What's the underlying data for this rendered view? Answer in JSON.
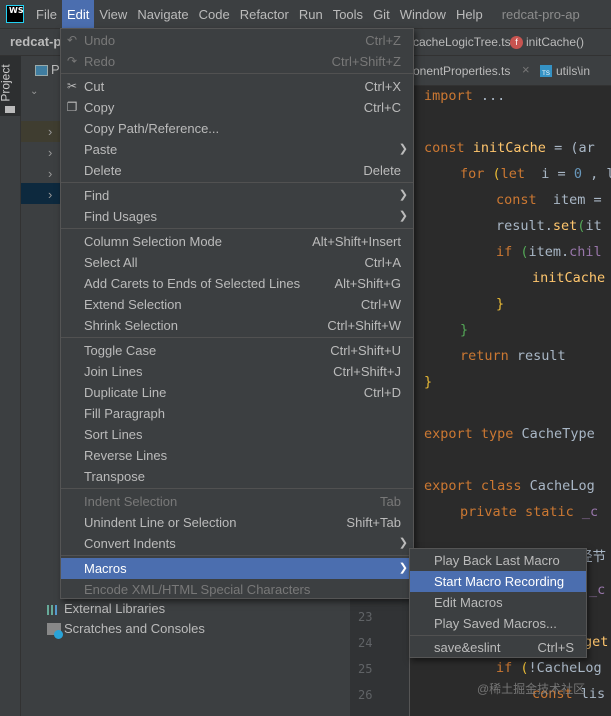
{
  "menubar": {
    "logo": "WS",
    "items": [
      "File",
      "Edit",
      "View",
      "Navigate",
      "Code",
      "Refactor",
      "Run",
      "Tools",
      "Git",
      "Window",
      "Help"
    ],
    "active": "Edit",
    "project_title": "redcat-pro-ap"
  },
  "navbar": {
    "project": "redcat-p",
    "file": "cacheLogicTree.ts",
    "function": "initCache()"
  },
  "tabs": [
    {
      "label": "onentProperties.ts"
    },
    {
      "label": "utils\\in"
    }
  ],
  "tool_window": {
    "label": "Project"
  },
  "project_panel": {
    "header": "P",
    "items": [
      "External Libraries",
      "Scratches and Consoles"
    ]
  },
  "edit_menu": [
    {
      "label": "Undo",
      "shortcut": "Ctrl+Z",
      "disabled": true,
      "icon": "undo-icon"
    },
    {
      "label": "Redo",
      "shortcut": "Ctrl+Shift+Z",
      "disabled": true,
      "icon": "redo-icon"
    },
    {
      "sep": true
    },
    {
      "label": "Cut",
      "shortcut": "Ctrl+X",
      "icon": "scissors-icon"
    },
    {
      "label": "Copy",
      "shortcut": "Ctrl+C",
      "icon": "copy-icon"
    },
    {
      "label": "Copy Path/Reference..."
    },
    {
      "label": "Paste",
      "submenu": true
    },
    {
      "label": "Delete",
      "shortcut": "Delete"
    },
    {
      "sep": true
    },
    {
      "label": "Find",
      "submenu": true
    },
    {
      "label": "Find Usages",
      "submenu": true
    },
    {
      "sep": true
    },
    {
      "label": "Column Selection Mode",
      "shortcut": "Alt+Shift+Insert"
    },
    {
      "label": "Select All",
      "shortcut": "Ctrl+A"
    },
    {
      "label": "Add Carets to Ends of Selected Lines",
      "shortcut": "Alt+Shift+G"
    },
    {
      "label": "Extend Selection",
      "shortcut": "Ctrl+W"
    },
    {
      "label": "Shrink Selection",
      "shortcut": "Ctrl+Shift+W"
    },
    {
      "sep": true
    },
    {
      "label": "Toggle Case",
      "shortcut": "Ctrl+Shift+U"
    },
    {
      "label": "Join Lines",
      "shortcut": "Ctrl+Shift+J"
    },
    {
      "label": "Duplicate Line",
      "shortcut": "Ctrl+D"
    },
    {
      "label": "Fill Paragraph"
    },
    {
      "label": "Sort Lines"
    },
    {
      "label": "Reverse Lines"
    },
    {
      "label": "Transpose"
    },
    {
      "sep": true
    },
    {
      "label": "Indent Selection",
      "shortcut": "Tab",
      "disabled": true
    },
    {
      "label": "Unindent Line or Selection",
      "shortcut": "Shift+Tab"
    },
    {
      "label": "Convert Indents",
      "submenu": true
    },
    {
      "sep": true
    },
    {
      "label": "Macros",
      "submenu": true,
      "selected": true
    },
    {
      "label": "Encode XML/HTML Special Characters",
      "disabled": true
    }
  ],
  "macros_submenu": [
    {
      "label": "Play Back Last Macro"
    },
    {
      "label": "Start Macro Recording",
      "selected": true
    },
    {
      "label": "Edit Macros"
    },
    {
      "label": "Play Saved Macros..."
    },
    {
      "sep": true
    },
    {
      "label": "save&eslint",
      "shortcut": "Ctrl+S"
    }
  ],
  "editor": {
    "line_numbers": [
      "23",
      "24",
      "25",
      "26"
    ],
    "lines": [
      [
        [
          "kw",
          "import "
        ],
        [
          "",
          "..."
        ]
      ],
      [
        [
          "kw",
          "const "
        ],
        [
          "fn",
          "initCache"
        ],
        [
          "",
          " = (ar"
        ]
      ],
      [
        [
          "kw",
          "for "
        ],
        [
          "br",
          "("
        ],
        [
          "kw",
          "let "
        ],
        [
          "",
          " i = "
        ],
        [
          "num",
          "0"
        ],
        [
          "",
          " , l"
        ]
      ],
      [
        [
          "kw",
          "const "
        ],
        [
          "",
          " item ="
        ]
      ],
      [
        [
          "",
          "result."
        ],
        [
          "fn",
          "set"
        ],
        [
          "gr",
          "("
        ],
        [
          "",
          "it"
        ]
      ],
      [
        [
          "kw",
          "if "
        ],
        [
          "gr",
          "("
        ],
        [
          "",
          "item."
        ],
        [
          "pr",
          "chil"
        ]
      ],
      [
        [
          "fn",
          "initCache"
        ]
      ],
      [
        [
          "br",
          "}"
        ]
      ],
      [
        [
          "gr",
          "}"
        ]
      ],
      [
        [
          "kw",
          "return "
        ],
        [
          "",
          "result"
        ]
      ],
      [
        [
          "br",
          "}"
        ]
      ],
      [
        [
          "kw",
          "export type "
        ],
        [
          "",
          "CacheType"
        ]
      ],
      [
        [
          "kw",
          "export class "
        ],
        [
          "",
          "CacheLog"
        ]
      ],
      [
        [
          "kw",
          "private static "
        ],
        [
          "pr",
          "_c"
        ]
      ],
      [
        [
          "",
          "经节"
        ]
      ],
      [
        [
          "pr",
          "_c"
        ]
      ],
      [
        [
          "fn",
          "get"
        ]
      ],
      [
        [
          "kw",
          "if "
        ],
        [
          "br",
          "("
        ],
        [
          "",
          "!CacheLog"
        ]
      ],
      [
        [
          "kw",
          "const "
        ],
        [
          "",
          "lis"
        ]
      ]
    ],
    "watermark": "@稀土掘金技术社区"
  },
  "colors": {
    "accent": "#4b6eaf",
    "menu_bg": "#3c3f41",
    "editor_bg": "#2b2b2b"
  }
}
